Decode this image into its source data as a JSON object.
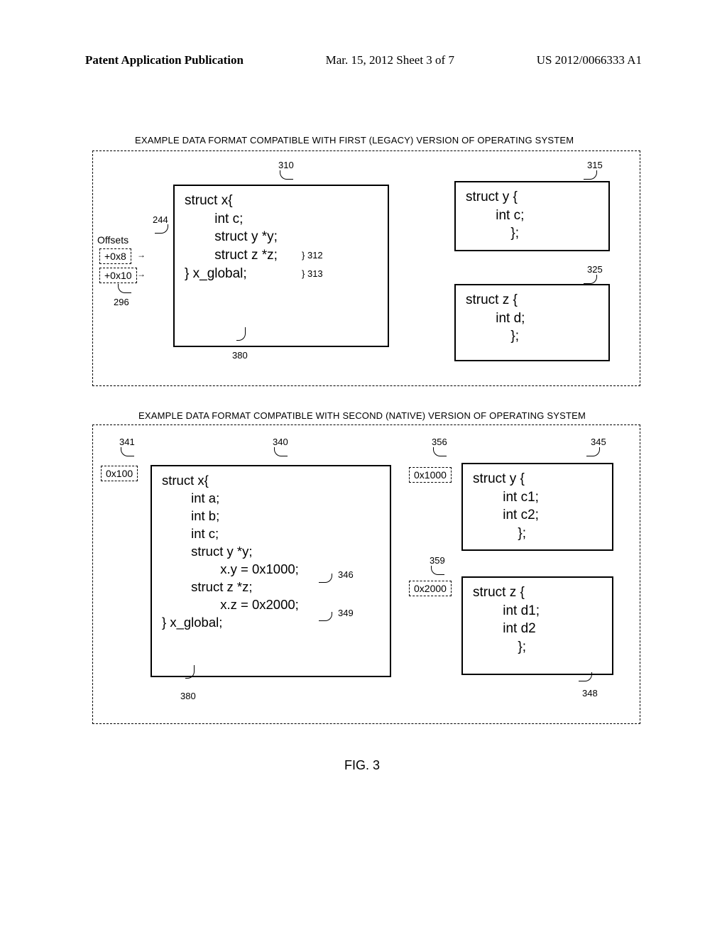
{
  "header": {
    "left": "Patent Application Publication",
    "mid": "Mar. 15, 2012  Sheet 3 of 7",
    "right": "US 2012/0066333 A1"
  },
  "section1": {
    "title": "EXAMPLE DATA FORMAT COMPATIBLE WITH FIRST (LEGACY) VERSION  OF OPERATING SYSTEM"
  },
  "section2": {
    "title": "EXAMPLE DATA FORMAT COMPATIBLE WITH SECOND (NATIVE) VERSION  OF OPERATING SYSTEM"
  },
  "legacy": {
    "struct_x": "struct x{\n        int c;\n        struct y *y;\n        struct z *z;\n} x_global;",
    "struct_y": "struct y {\n        int c;\n            };",
    "struct_z": "struct z {\n        int d;\n            };",
    "offsets_label": "Offsets",
    "offset1": "+0x8",
    "offset2": "+0x10",
    "ref_244": "244",
    "ref_296": "296",
    "ref_310": "310",
    "ref_312": "312",
    "ref_313": "313",
    "ref_315": "315",
    "ref_325": "325",
    "ref_380": "380"
  },
  "native": {
    "struct_x": "struct x{\n        int a;\n        int b;\n        int c;\n        struct y *y;\n                x.y = 0x1000;\n        struct z *z;\n                x.z = 0x2000;\n} x_global;",
    "struct_y": "struct y {\n        int c1;\n        int c2;\n            };",
    "struct_z": "struct z {\n        int d1;\n        int d2\n            };",
    "addr_341": "0x100",
    "addr_356": "0x1000",
    "addr_359": "0x2000",
    "ref_340": "340",
    "ref_341": "341",
    "ref_345": "345",
    "ref_346": "346",
    "ref_348": "348",
    "ref_349": "349",
    "ref_356": "356",
    "ref_359": "359",
    "ref_380": "380"
  },
  "figure_caption": "FIG. 3"
}
